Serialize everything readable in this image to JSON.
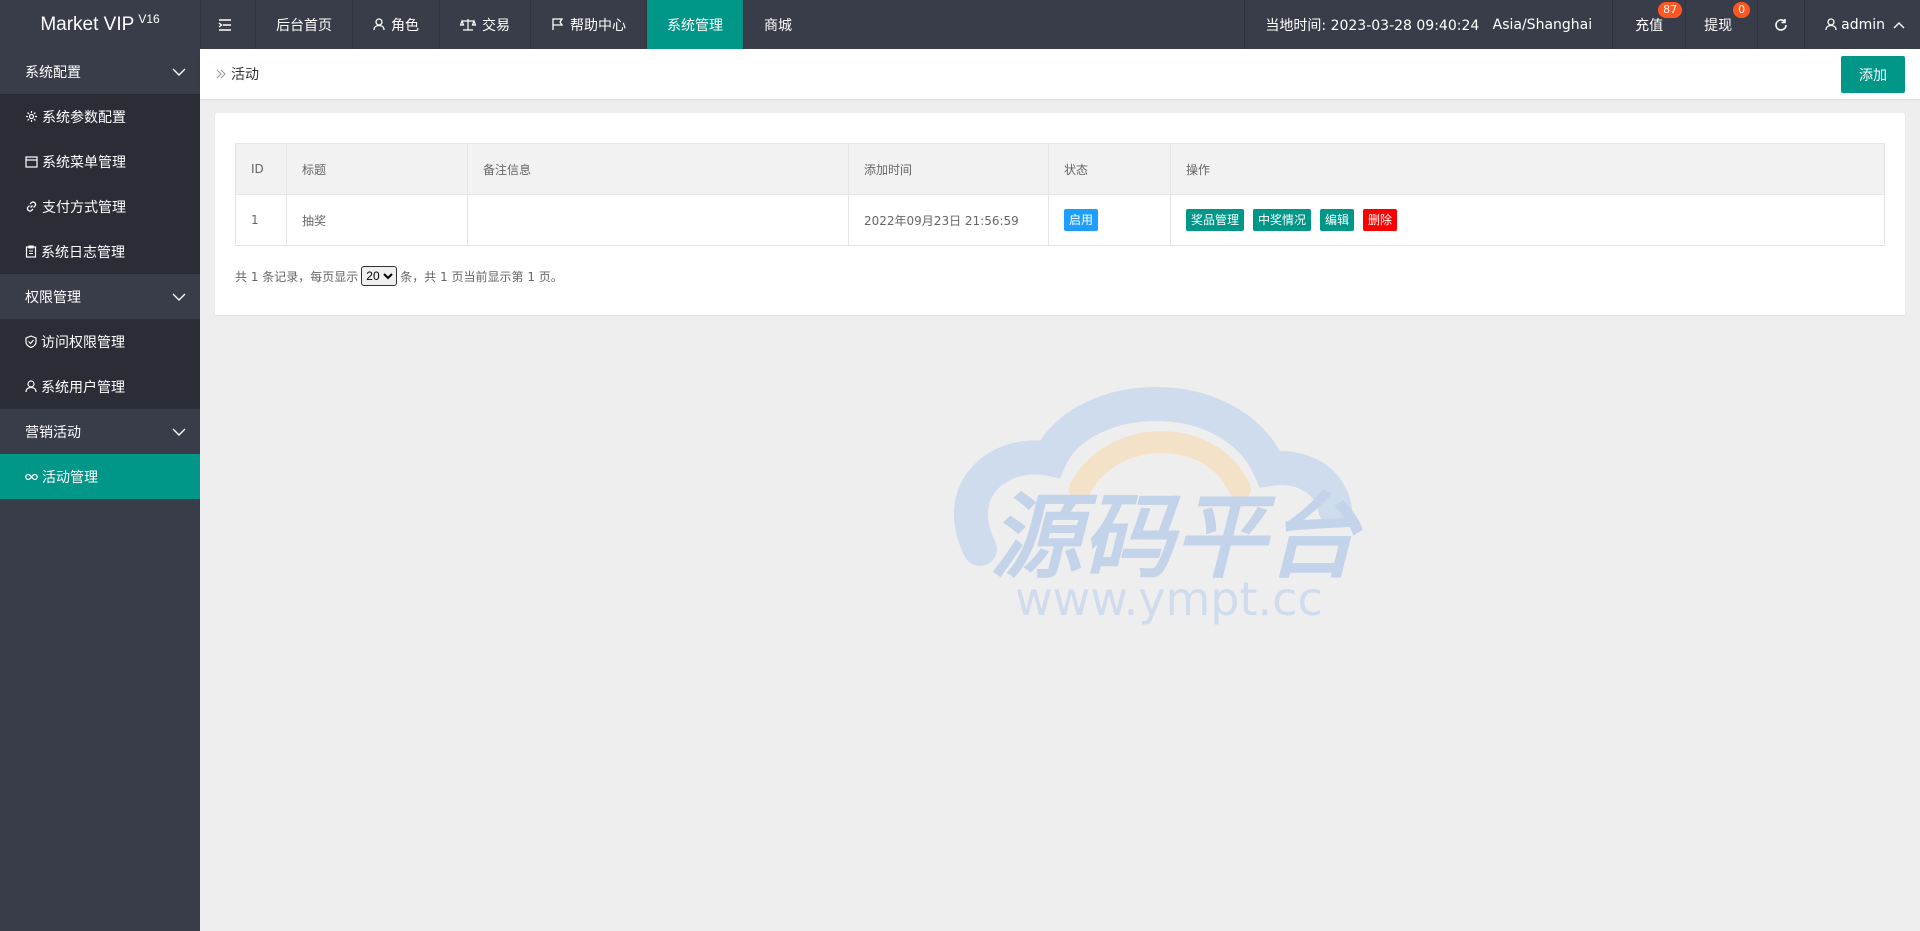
{
  "header": {
    "logo": "Market VIP",
    "logo_version": "V16",
    "nav": [
      {
        "label": "后台首页"
      },
      {
        "label": "角色"
      },
      {
        "label": "交易"
      },
      {
        "label": "帮助中心"
      },
      {
        "label": "系统管理"
      },
      {
        "label": "商城"
      }
    ],
    "time_label": "当地时间: 2023-03-28 09:40:24",
    "timezone": "Asia/Shanghai",
    "recharge_label": "充值",
    "recharge_count": "87",
    "withdraw_label": "提现",
    "withdraw_count": "0",
    "user_label": "admin"
  },
  "sidebar": {
    "groups": [
      {
        "label": "系统配置",
        "items": [
          "系统参数配置",
          "系统菜单管理",
          "支付方式管理",
          "系统日志管理"
        ]
      },
      {
        "label": "权限管理",
        "items": [
          "访问权限管理",
          "系统用户管理"
        ]
      },
      {
        "label": "营销活动",
        "items": [
          "活动管理"
        ]
      }
    ]
  },
  "breadcrumb": {
    "label": "活动"
  },
  "add_button": "添加",
  "table": {
    "headers": [
      "ID",
      "标题",
      "备注信息",
      "添加时间",
      "状态",
      "操作"
    ],
    "rows": [
      {
        "id": "1",
        "title": "抽奖",
        "note": "",
        "time": "2022年09月23日 21:56:59",
        "status": "启用",
        "actions": [
          "奖品管理",
          "中奖情况",
          "编辑",
          "删除"
        ]
      }
    ]
  },
  "pager": {
    "prefix": "共 1 条记录，每页显示",
    "page_size": "20",
    "suffix": "条，共 1 页当前显示第 1 页。"
  },
  "watermark": {
    "text": "源码平台",
    "url": "www.ympt.cc"
  },
  "colors": {
    "accent": "#009688",
    "header_bg": "#393d49",
    "badge": "#ff5722",
    "status_blue": "#1e9fff",
    "danger": "#ff0000"
  }
}
